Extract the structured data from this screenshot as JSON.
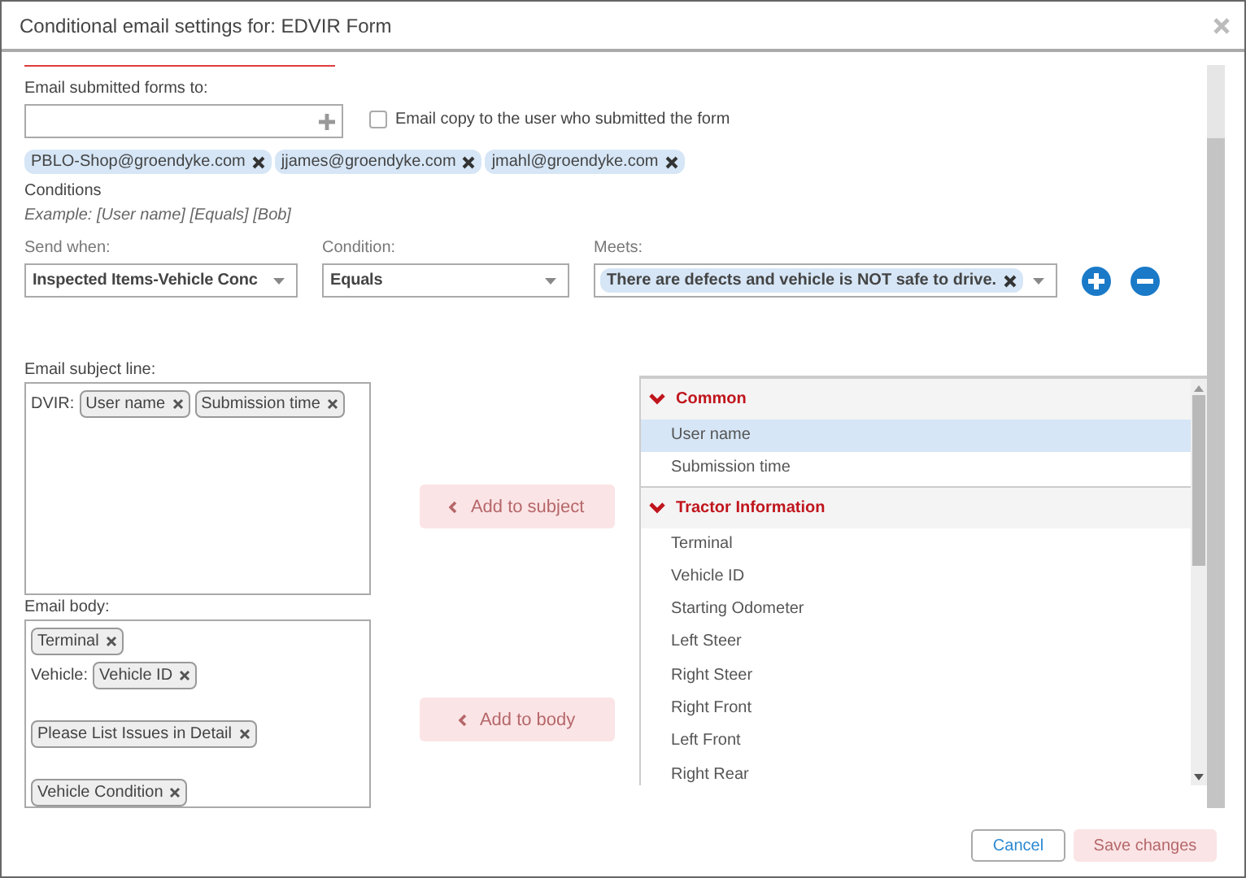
{
  "window": {
    "title": "Conditional email settings for: EDVIR Form"
  },
  "recipients": {
    "label": "Email submitted forms to:",
    "copy_checkbox": {
      "label": "Email copy to the user who submitted the form",
      "checked": false
    },
    "emails": [
      "PBLO-Shop@groendyke.com",
      "jjames@groendyke.com",
      "jmahl@groendyke.com"
    ]
  },
  "conditions": {
    "title": "Conditions",
    "example": "Example: [User name] [Equals] [Bob]",
    "send_when": {
      "label": "Send when:",
      "value": "Inspected Items-Vehicle Conc"
    },
    "condition": {
      "label": "Condition:",
      "value": "Equals"
    },
    "meets": {
      "label": "Meets:",
      "values": [
        "There are defects and vehicle is NOT safe to drive."
      ]
    }
  },
  "subject": {
    "label": "Email subject line:",
    "lines": [
      {
        "kind": "tags",
        "prefix": "DVIR:",
        "tags": [
          "User name",
          "Submission time"
        ]
      }
    ]
  },
  "body": {
    "label": "Email body:",
    "lines": [
      {
        "kind": "tags",
        "tags": [
          "Terminal"
        ]
      },
      {
        "kind": "tags",
        "prefix": "Vehicle:",
        "tags": [
          "Vehicle ID"
        ]
      },
      {
        "kind": "blank"
      },
      {
        "kind": "tags",
        "tags": [
          "Please List Issues in Detail"
        ]
      },
      {
        "kind": "blank"
      },
      {
        "kind": "tags",
        "tags": [
          "Vehicle Condition"
        ]
      }
    ]
  },
  "add_buttons": [
    {
      "label": "Add to subject",
      "disabled": true
    },
    {
      "label": "Add to body",
      "disabled": true
    }
  ],
  "fields": {
    "groups": [
      {
        "name": "Common",
        "expanded": true,
        "items": [
          {
            "label": "User name",
            "selected": true
          },
          {
            "label": "Submission time",
            "selected": false
          }
        ]
      },
      {
        "name": "Tractor Information",
        "expanded": true,
        "items": [
          {
            "label": "Terminal",
            "selected": false
          },
          {
            "label": "Vehicle ID",
            "selected": false
          },
          {
            "label": "Starting Odometer",
            "selected": false
          },
          {
            "label": "Left Steer",
            "selected": false
          },
          {
            "label": "Right Steer",
            "selected": false
          },
          {
            "label": "Right Front",
            "selected": false
          },
          {
            "label": "Left Front",
            "selected": false
          },
          {
            "label": "Right Rear",
            "selected": false
          }
        ]
      }
    ]
  },
  "buttons": [
    {
      "label": "Cancel",
      "kind": "secondary",
      "disabled": false
    },
    {
      "label": "Save changes",
      "kind": "primary",
      "disabled": true
    }
  ]
}
